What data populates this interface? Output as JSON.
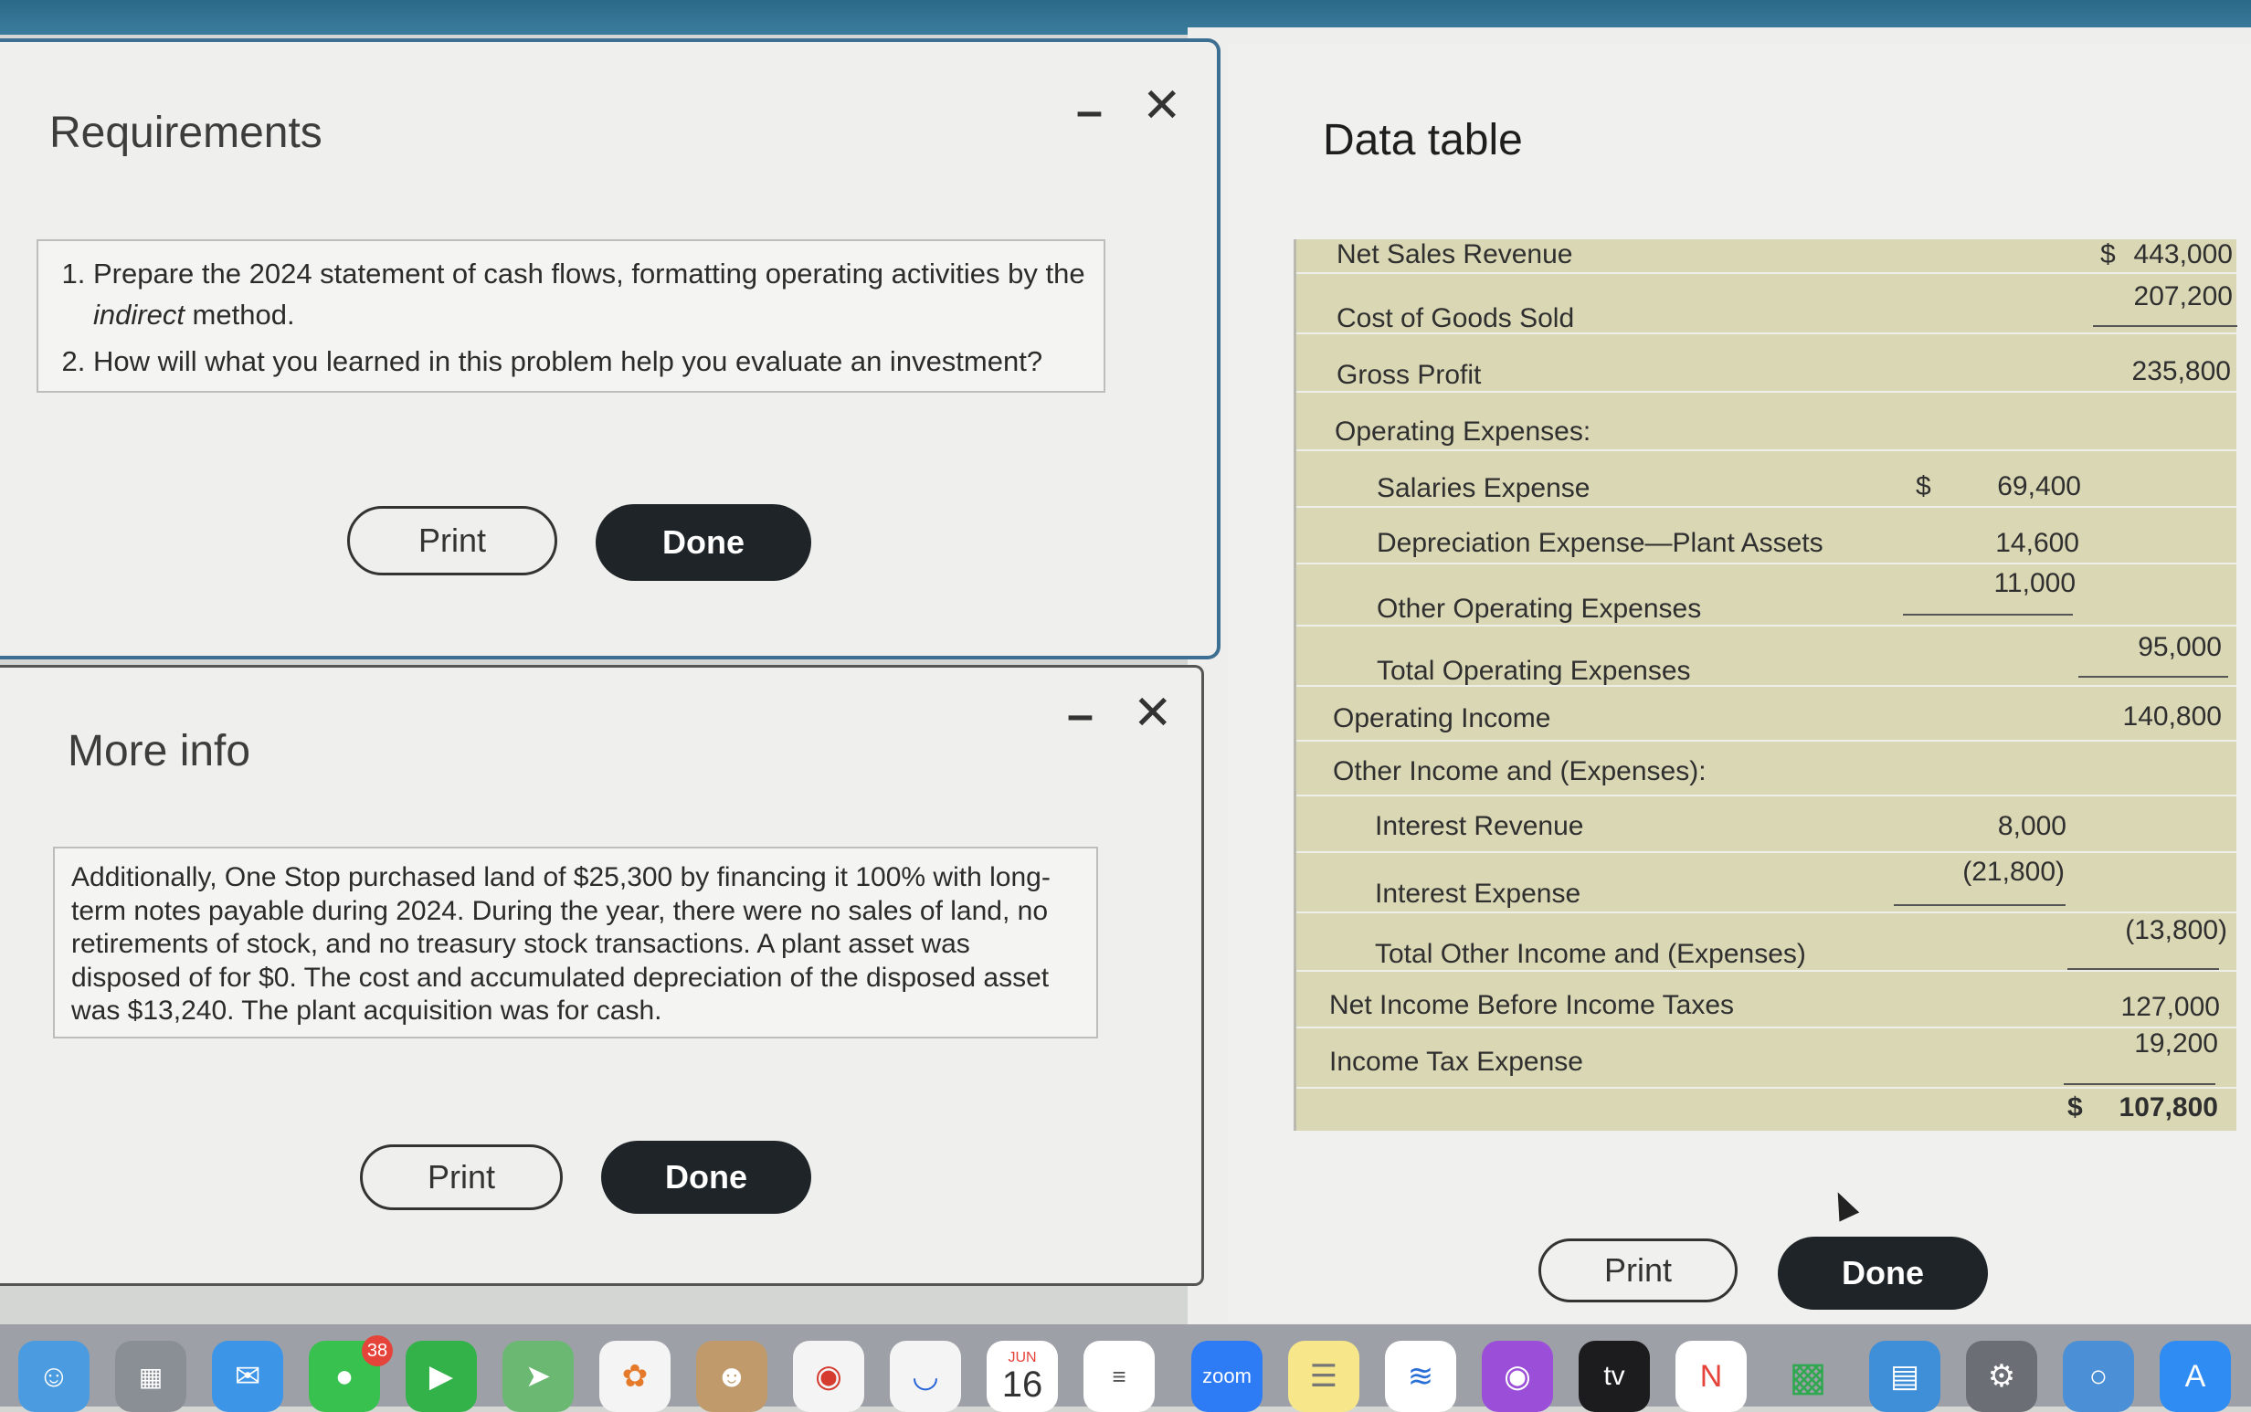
{
  "requirements": {
    "title": "Requirements",
    "items": [
      {
        "num": "1.",
        "pre": "Prepare the 2024 statement of cash flows, formatting operating activities by the ",
        "em": "indirect",
        "post": " method."
      },
      {
        "num": "2.",
        "pre": "How will what you learned in this problem help you evaluate an investment?",
        "em": "",
        "post": ""
      }
    ],
    "print_label": "Print",
    "done_label": "Done"
  },
  "more_info": {
    "title": "More info",
    "text": "Additionally, One Stop purchased land of $25,300 by financing it 100% with long-term notes payable during 2024. During the year, there were no sales of land, no retirements of stock, and no treasury stock transactions. A plant asset was disposed of for $0. The cost and accumulated depreciation of the disposed asset was $13,240. The plant acquisition was for cash.",
    "print_label": "Print",
    "done_label": "Done"
  },
  "data_table": {
    "title": "Data table",
    "rows": [
      {
        "label": "Net Sales Revenue",
        "sign1": "",
        "col1": "",
        "sign2": "$",
        "col2": "443,000"
      },
      {
        "label": "Cost of Goods Sold",
        "sign1": "",
        "col1": "",
        "sign2": "",
        "col2": "207,200"
      },
      {
        "label": "Gross Profit",
        "sign1": "",
        "col1": "",
        "sign2": "",
        "col2": "235,800"
      },
      {
        "label": "Operating Expenses:",
        "sign1": "",
        "col1": "",
        "sign2": "",
        "col2": ""
      },
      {
        "label": "Salaries Expense",
        "sign1": "$",
        "col1": "69,400",
        "sign2": "",
        "col2": ""
      },
      {
        "label": "Depreciation Expense—Plant Assets",
        "sign1": "",
        "col1": "14,600",
        "sign2": "",
        "col2": ""
      },
      {
        "label": "Other Operating Expenses",
        "sign1": "",
        "col1": "11,000",
        "sign2": "",
        "col2": ""
      },
      {
        "label": "Total Operating Expenses",
        "sign1": "",
        "col1": "",
        "sign2": "",
        "col2": "95,000"
      },
      {
        "label": "Operating Income",
        "sign1": "",
        "col1": "",
        "sign2": "",
        "col2": "140,800"
      },
      {
        "label": "Other Income and (Expenses):",
        "sign1": "",
        "col1": "",
        "sign2": "",
        "col2": ""
      },
      {
        "label": "Interest Revenue",
        "sign1": "",
        "col1": "8,000",
        "sign2": "",
        "col2": ""
      },
      {
        "label": "Interest Expense",
        "sign1": "",
        "col1": "(21,800)",
        "sign2": "",
        "col2": ""
      },
      {
        "label": "Total Other Income and (Expenses)",
        "sign1": "",
        "col1": "",
        "sign2": "",
        "col2": "(13,800)"
      },
      {
        "label": "Net Income Before Income Taxes",
        "sign1": "",
        "col1": "",
        "sign2": "",
        "col2": "127,000"
      },
      {
        "label": "Income Tax Expense",
        "sign1": "",
        "col1": "",
        "sign2": "",
        "col2": "19,200"
      },
      {
        "label": "",
        "sign1": "",
        "col1": "",
        "sign2": "$",
        "col2": "107,800"
      }
    ],
    "print_label": "Print",
    "done_label": "Done"
  },
  "dock": {
    "messages_badge": "38",
    "calendar_month": "JUN",
    "calendar_day": "16",
    "zoom_label": "zoom",
    "tv_label": "tv",
    "icons": [
      "finder-icon",
      "launchpad-icon",
      "mail-icon",
      "messages-icon",
      "facetime-icon",
      "maps-icon",
      "photos-icon",
      "contacts-icon",
      "chrome-icon",
      "app-icon",
      "calendar-icon",
      "reminders-icon",
      "zoom-icon",
      "notes-icon",
      "freeform-icon",
      "podcasts-icon",
      "appletv-icon",
      "news-icon",
      "numbers-icon",
      "keynote-icon",
      "settings-icon",
      "network-icon",
      "appstore-icon"
    ]
  }
}
